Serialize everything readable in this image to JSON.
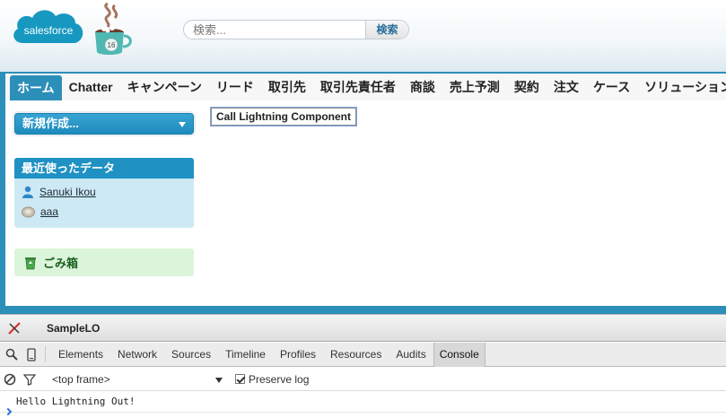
{
  "header": {
    "logo_text": "salesforce",
    "mascot_badge": "16",
    "search": {
      "placeholder": "検索...",
      "button_label": "検索"
    }
  },
  "tabs": [
    {
      "label": "ホーム",
      "active": true
    },
    {
      "label": "Chatter"
    },
    {
      "label": "キャンペーン"
    },
    {
      "label": "リード"
    },
    {
      "label": "取引先"
    },
    {
      "label": "取引先責任者"
    },
    {
      "label": "商談"
    },
    {
      "label": "売上予測"
    },
    {
      "label": "契約"
    },
    {
      "label": "注文"
    },
    {
      "label": "ケース"
    },
    {
      "label": "ソリューション"
    }
  ],
  "sidebar": {
    "new_button_label": "新規作成...",
    "recent_header": "最近使ったデータ",
    "recent_items": [
      {
        "label": "Sanuki Ikou",
        "icon": "contact-person-icon"
      },
      {
        "label": "aaa",
        "icon": "record-icon"
      }
    ],
    "trash_label": "ごみ箱"
  },
  "main": {
    "lightning_button_label": "Call Lightning Component"
  },
  "devtools": {
    "title": "SampleLO",
    "tabs": [
      "Elements",
      "Network",
      "Sources",
      "Timeline",
      "Profiles",
      "Resources",
      "Audits",
      "Console"
    ],
    "active_tab": "Console",
    "frame_select": "<top frame>",
    "preserve_log_label": "Preserve log",
    "preserve_log_checked": true,
    "log_lines": [
      "Hello Lightning Out!"
    ]
  },
  "colors": {
    "brand_blue": "#2c8fb9",
    "sidebar_blue": "#1f91c2",
    "recent_bg": "#cde9f4",
    "trash_bg": "#dbf5db"
  }
}
